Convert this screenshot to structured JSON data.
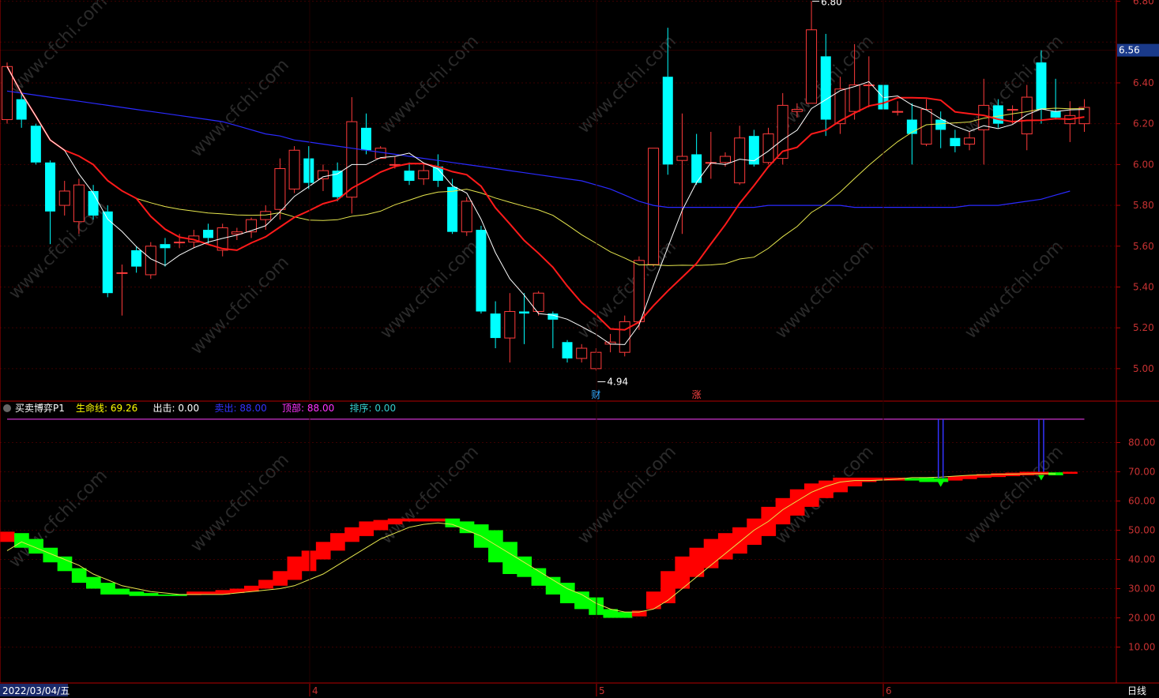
{
  "colors": {
    "up": "#ff3b3b",
    "down": "#00ffff",
    "ma5": "#ffffff",
    "ma10": "#ff1a1a",
    "ma20": "#e6e64d",
    "ma60": "#2a2aff",
    "axis": "#b30000",
    "grid": "#3a0000",
    "green_block": "#00ff00",
    "red_block": "#ff0000",
    "top_line": "#cc33cc",
    "exit_line": "#3333ff"
  },
  "price_axis": {
    "ticks": [
      "6.80",
      "6.40",
      "6.20",
      "6.00",
      "5.80",
      "5.60",
      "5.40",
      "5.20",
      "5.00"
    ],
    "current": "6.56"
  },
  "indicator_axis": {
    "ticks": [
      "80.00",
      "70.00",
      "60.00",
      "50.00",
      "40.00",
      "30.00",
      "20.00",
      "10.00"
    ]
  },
  "annotations": {
    "high_label": "6.80",
    "low_label": "4.94",
    "marker_cai": "财",
    "marker_zhang": "涨"
  },
  "indicator_header": {
    "name": "买卖博弈P1",
    "items": [
      {
        "label": "生命线:",
        "value": "69.26",
        "color": "#ffff00"
      },
      {
        "label": "出击:",
        "value": "0.00",
        "color": "#ffffff"
      },
      {
        "label": "卖出:",
        "value": "88.00",
        "color": "#3333ff"
      },
      {
        "label": "顶部:",
        "value": "88.00",
        "color": "#ff33ff"
      },
      {
        "label": "排序:",
        "value": "0.00",
        "color": "#33cccc"
      }
    ]
  },
  "bottom_bar": {
    "date": "2022/03/04/五",
    "months": [
      "4",
      "5",
      "6"
    ],
    "period": "日线"
  },
  "watermark": "www.cfchi.com",
  "chart_data": [
    {
      "type": "candlestick",
      "ylim": [
        4.88,
        6.82
      ],
      "candles": [
        {
          "o": 6.22,
          "c": 6.48,
          "h": 6.5,
          "l": 6.2
        },
        {
          "o": 6.32,
          "c": 6.22,
          "h": 6.35,
          "l": 6.18
        },
        {
          "o": 6.19,
          "c": 6.01,
          "h": 6.2,
          "l": 6.0
        },
        {
          "o": 6.01,
          "c": 5.77,
          "h": 6.02,
          "l": 5.61
        },
        {
          "o": 5.8,
          "c": 5.87,
          "h": 5.92,
          "l": 5.75
        },
        {
          "o": 5.72,
          "c": 5.9,
          "h": 5.93,
          "l": 5.66
        },
        {
          "o": 5.87,
          "c": 5.75,
          "h": 5.9,
          "l": 5.73
        },
        {
          "o": 5.77,
          "c": 5.37,
          "h": 5.8,
          "l": 5.35
        },
        {
          "o": 5.47,
          "c": 5.47,
          "h": 5.51,
          "l": 5.26
        },
        {
          "o": 5.58,
          "c": 5.5,
          "h": 5.6,
          "l": 5.47
        },
        {
          "o": 5.46,
          "c": 5.6,
          "h": 5.62,
          "l": 5.44
        },
        {
          "o": 5.61,
          "c": 5.59,
          "h": 5.64,
          "l": 5.5
        },
        {
          "o": 5.62,
          "c": 5.62,
          "h": 5.66,
          "l": 5.59
        },
        {
          "o": 5.62,
          "c": 5.65,
          "h": 5.68,
          "l": 5.59
        },
        {
          "o": 5.68,
          "c": 5.64,
          "h": 5.71,
          "l": 5.61
        },
        {
          "o": 5.58,
          "c": 5.69,
          "h": 5.71,
          "l": 5.55
        },
        {
          "o": 5.66,
          "c": 5.67,
          "h": 5.69,
          "l": 5.63
        },
        {
          "o": 5.67,
          "c": 5.73,
          "h": 5.74,
          "l": 5.64
        },
        {
          "o": 5.73,
          "c": 5.77,
          "h": 5.8,
          "l": 5.68
        },
        {
          "o": 5.78,
          "c": 5.98,
          "h": 6.03,
          "l": 5.73
        },
        {
          "o": 5.88,
          "c": 6.07,
          "h": 6.09,
          "l": 5.86
        },
        {
          "o": 6.03,
          "c": 5.91,
          "h": 6.09,
          "l": 5.88
        },
        {
          "o": 5.93,
          "c": 5.97,
          "h": 6.0,
          "l": 5.87
        },
        {
          "o": 5.97,
          "c": 5.84,
          "h": 6.01,
          "l": 5.82
        },
        {
          "o": 5.84,
          "c": 6.21,
          "h": 6.33,
          "l": 5.76
        },
        {
          "o": 6.18,
          "c": 6.07,
          "h": 6.25,
          "l": 6.05
        },
        {
          "o": 6.03,
          "c": 6.08,
          "h": 6.09,
          "l": 6.03
        },
        {
          "o": 6.0,
          "c": 6.0,
          "h": 6.04,
          "l": 5.98
        },
        {
          "o": 5.97,
          "c": 5.92,
          "h": 6.01,
          "l": 5.9
        },
        {
          "o": 5.93,
          "c": 5.97,
          "h": 6.0,
          "l": 5.9
        },
        {
          "o": 5.99,
          "c": 5.92,
          "h": 6.05,
          "l": 5.89
        },
        {
          "o": 5.89,
          "c": 5.67,
          "h": 5.93,
          "l": 5.66
        },
        {
          "o": 5.67,
          "c": 5.82,
          "h": 5.84,
          "l": 5.65
        },
        {
          "o": 5.68,
          "c": 5.28,
          "h": 5.7,
          "l": 5.27
        },
        {
          "o": 5.27,
          "c": 5.15,
          "h": 5.33,
          "l": 5.1
        },
        {
          "o": 5.15,
          "c": 5.28,
          "h": 5.37,
          "l": 5.03
        },
        {
          "o": 5.28,
          "c": 5.27,
          "h": 5.37,
          "l": 5.12
        },
        {
          "o": 5.28,
          "c": 5.37,
          "h": 5.38,
          "l": 5.26
        },
        {
          "o": 5.27,
          "c": 5.24,
          "h": 5.28,
          "l": 5.1
        },
        {
          "o": 5.13,
          "c": 5.05,
          "h": 5.14,
          "l": 5.03
        },
        {
          "o": 5.05,
          "c": 5.1,
          "h": 5.12,
          "l": 5.03
        },
        {
          "o": 5.0,
          "c": 5.08,
          "h": 5.1,
          "l": 4.99
        },
        {
          "o": 5.12,
          "c": 5.13,
          "h": 5.17,
          "l": 5.08
        },
        {
          "o": 5.08,
          "c": 5.23,
          "h": 5.26,
          "l": 5.06
        },
        {
          "o": 5.23,
          "c": 5.53,
          "h": 5.55,
          "l": 5.19
        },
        {
          "o": 5.51,
          "c": 6.08,
          "h": 6.08,
          "l": 5.5
        },
        {
          "o": 6.43,
          "c": 6.0,
          "h": 6.67,
          "l": 5.95
        },
        {
          "o": 6.02,
          "c": 6.04,
          "h": 6.25,
          "l": 5.66
        },
        {
          "o": 6.05,
          "c": 5.91,
          "h": 6.15,
          "l": 5.9
        },
        {
          "o": 6.01,
          "c": 6.01,
          "h": 6.16,
          "l": 5.93
        },
        {
          "o": 6.01,
          "c": 6.04,
          "h": 6.06,
          "l": 5.99
        },
        {
          "o": 5.91,
          "c": 6.13,
          "h": 6.19,
          "l": 5.9
        },
        {
          "o": 6.14,
          "c": 6.0,
          "h": 6.17,
          "l": 5.99
        },
        {
          "o": 6.01,
          "c": 6.15,
          "h": 6.18,
          "l": 6.0
        },
        {
          "o": 6.03,
          "c": 6.29,
          "h": 6.35,
          "l": 6.0
        },
        {
          "o": 6.26,
          "c": 6.27,
          "h": 6.3,
          "l": 6.23
        },
        {
          "o": 6.3,
          "c": 6.66,
          "h": 6.8,
          "l": 6.3
        },
        {
          "o": 6.53,
          "c": 6.22,
          "h": 6.64,
          "l": 6.14
        },
        {
          "o": 6.2,
          "c": 6.37,
          "h": 6.43,
          "l": 6.15
        },
        {
          "o": 6.26,
          "c": 6.39,
          "h": 6.59,
          "l": 6.22
        },
        {
          "o": 6.39,
          "c": 6.39,
          "h": 6.53,
          "l": 6.28
        },
        {
          "o": 6.39,
          "c": 6.27,
          "h": 6.41,
          "l": 6.26
        },
        {
          "o": 6.26,
          "c": 6.26,
          "h": 6.31,
          "l": 6.24
        },
        {
          "o": 6.22,
          "c": 6.15,
          "h": 6.3,
          "l": 6.0
        },
        {
          "o": 6.1,
          "c": 6.27,
          "h": 6.32,
          "l": 6.09
        },
        {
          "o": 6.22,
          "c": 6.17,
          "h": 6.26,
          "l": 6.08
        },
        {
          "o": 6.13,
          "c": 6.09,
          "h": 6.17,
          "l": 6.06
        },
        {
          "o": 6.1,
          "c": 6.13,
          "h": 6.16,
          "l": 6.07
        },
        {
          "o": 6.17,
          "c": 6.29,
          "h": 6.42,
          "l": 6.0
        },
        {
          "o": 6.29,
          "c": 6.2,
          "h": 6.32,
          "l": 6.18
        },
        {
          "o": 6.27,
          "c": 6.27,
          "h": 6.29,
          "l": 6.2
        },
        {
          "o": 6.15,
          "c": 6.33,
          "h": 6.39,
          "l": 6.07
        },
        {
          "o": 6.5,
          "c": 6.27,
          "h": 6.56,
          "l": 6.2
        },
        {
          "o": 6.26,
          "c": 6.23,
          "h": 6.42,
          "l": 6.22
        },
        {
          "o": 6.2,
          "c": 6.24,
          "h": 6.31,
          "l": 6.11
        },
        {
          "o": 6.2,
          "c": 6.28,
          "h": 6.32,
          "l": 6.16
        }
      ],
      "ma60": [
        6.36,
        6.35,
        6.34,
        6.33,
        6.32,
        6.31,
        6.3,
        6.29,
        6.28,
        6.27,
        6.26,
        6.25,
        6.24,
        6.23,
        6.22,
        6.21,
        6.19,
        6.17,
        6.15,
        6.14,
        6.12,
        6.11,
        6.1,
        6.09,
        6.08,
        6.07,
        6.06,
        6.05,
        6.04,
        6.03,
        6.02,
        6.01,
        6.0,
        5.99,
        5.98,
        5.97,
        5.96,
        5.95,
        5.94,
        5.93,
        5.92,
        5.9,
        5.88,
        5.85,
        5.82,
        5.8,
        5.79,
        5.79,
        5.79,
        5.79,
        5.79,
        5.79,
        5.79,
        5.8,
        5.8,
        5.8,
        5.8,
        5.8,
        5.8,
        5.79,
        5.79,
        5.79,
        5.79,
        5.79,
        5.79,
        5.79,
        5.79,
        5.8,
        5.8,
        5.8,
        5.81,
        5.82,
        5.83,
        5.85,
        5.87
      ]
    },
    {
      "type": "indicator",
      "name": "买卖博弈P1",
      "ylim": [
        0,
        92
      ],
      "top_line": 88,
      "blocks": [
        {
          "bottom": 46,
          "top": 49.5,
          "color": "red"
        },
        {
          "bottom": 44,
          "top": 49,
          "color": "green"
        },
        {
          "bottom": 42,
          "top": 47,
          "color": "green"
        },
        {
          "bottom": 39,
          "top": 44,
          "color": "green"
        },
        {
          "bottom": 36,
          "top": 41,
          "color": "green"
        },
        {
          "bottom": 32,
          "top": 37,
          "color": "green"
        },
        {
          "bottom": 30,
          "top": 34,
          "color": "green"
        },
        {
          "bottom": 28,
          "top": 32,
          "color": "green"
        },
        {
          "bottom": 28,
          "top": 30,
          "color": "green"
        },
        {
          "bottom": 27.5,
          "top": 29,
          "color": "green"
        },
        {
          "bottom": 27.5,
          "top": 28.5,
          "color": "green"
        },
        {
          "bottom": 27.5,
          "top": 28,
          "color": "green"
        },
        {
          "bottom": 27.5,
          "top": 28,
          "color": "green"
        },
        {
          "bottom": 27.8,
          "top": 29,
          "color": "red"
        },
        {
          "bottom": 28,
          "top": 29,
          "color": "red"
        },
        {
          "bottom": 28,
          "top": 29.5,
          "color": "red"
        },
        {
          "bottom": 28.5,
          "top": 30,
          "color": "red"
        },
        {
          "bottom": 29,
          "top": 31,
          "color": "red"
        },
        {
          "bottom": 30,
          "top": 33,
          "color": "red"
        },
        {
          "bottom": 31,
          "top": 36,
          "color": "red"
        },
        {
          "bottom": 33,
          "top": 41,
          "color": "red"
        },
        {
          "bottom": 36,
          "top": 43,
          "color": "red"
        },
        {
          "bottom": 40,
          "top": 46,
          "color": "red"
        },
        {
          "bottom": 43,
          "top": 49,
          "color": "red"
        },
        {
          "bottom": 46,
          "top": 51,
          "color": "red"
        },
        {
          "bottom": 48,
          "top": 53,
          "color": "red"
        },
        {
          "bottom": 50,
          "top": 53.5,
          "color": "red"
        },
        {
          "bottom": 52,
          "top": 54,
          "color": "red"
        },
        {
          "bottom": 53,
          "top": 54,
          "color": "red"
        },
        {
          "bottom": 53,
          "top": 54,
          "color": "red"
        },
        {
          "bottom": 53,
          "top": 54,
          "color": "red"
        },
        {
          "bottom": 51,
          "top": 54,
          "color": "green"
        },
        {
          "bottom": 49,
          "top": 53,
          "color": "green"
        },
        {
          "bottom": 44,
          "top": 52,
          "color": "green"
        },
        {
          "bottom": 39,
          "top": 50,
          "color": "green"
        },
        {
          "bottom": 35,
          "top": 46,
          "color": "green"
        },
        {
          "bottom": 34,
          "top": 41,
          "color": "green"
        },
        {
          "bottom": 31,
          "top": 37,
          "color": "green"
        },
        {
          "bottom": 28,
          "top": 34,
          "color": "green"
        },
        {
          "bottom": 25,
          "top": 32,
          "color": "green"
        },
        {
          "bottom": 23,
          "top": 29,
          "color": "green"
        },
        {
          "bottom": 21,
          "top": 27,
          "color": "green"
        },
        {
          "bottom": 20,
          "top": 23,
          "color": "green"
        },
        {
          "bottom": 20,
          "top": 22,
          "color": "green"
        },
        {
          "bottom": 20.5,
          "top": 22.5,
          "color": "red"
        },
        {
          "bottom": 23,
          "top": 29,
          "color": "red"
        },
        {
          "bottom": 25,
          "top": 36,
          "color": "red"
        },
        {
          "bottom": 30,
          "top": 41,
          "color": "red"
        },
        {
          "bottom": 34,
          "top": 44,
          "color": "red"
        },
        {
          "bottom": 37,
          "top": 47,
          "color": "red"
        },
        {
          "bottom": 40,
          "top": 49,
          "color": "red"
        },
        {
          "bottom": 42,
          "top": 51,
          "color": "red"
        },
        {
          "bottom": 45,
          "top": 54,
          "color": "red"
        },
        {
          "bottom": 48,
          "top": 58,
          "color": "red"
        },
        {
          "bottom": 52,
          "top": 61,
          "color": "red"
        },
        {
          "bottom": 55,
          "top": 64,
          "color": "red"
        },
        {
          "bottom": 58,
          "top": 66,
          "color": "red"
        },
        {
          "bottom": 61,
          "top": 67,
          "color": "red"
        },
        {
          "bottom": 63,
          "top": 68,
          "color": "red"
        },
        {
          "bottom": 65,
          "top": 68,
          "color": "red"
        },
        {
          "bottom": 66.5,
          "top": 68,
          "color": "red"
        },
        {
          "bottom": 67,
          "top": 68,
          "color": "red"
        },
        {
          "bottom": 67,
          "top": 68,
          "color": "red"
        },
        {
          "bottom": 67,
          "top": 67.8,
          "color": "green"
        },
        {
          "bottom": 66.5,
          "top": 68,
          "color": "green"
        },
        {
          "bottom": 66.5,
          "top": 67.8,
          "color": "green"
        },
        {
          "bottom": 67,
          "top": 68.5,
          "color": "red"
        },
        {
          "bottom": 67.5,
          "top": 68.8,
          "color": "red"
        },
        {
          "bottom": 68,
          "top": 69.2,
          "color": "red"
        },
        {
          "bottom": 68.2,
          "top": 69.5,
          "color": "red"
        },
        {
          "bottom": 68.5,
          "top": 69.7,
          "color": "red"
        },
        {
          "bottom": 68.8,
          "top": 70,
          "color": "red"
        },
        {
          "bottom": 69,
          "top": 70,
          "color": "red"
        },
        {
          "bottom": 68.8,
          "top": 69.8,
          "color": "green"
        },
        {
          "bottom": 69.3,
          "top": 70,
          "color": "red"
        }
      ],
      "life_line": [
        43,
        46,
        44,
        42,
        40,
        38,
        35,
        33,
        31,
        30,
        29,
        28.5,
        28,
        28,
        28,
        28,
        28.5,
        29,
        29.5,
        30,
        31,
        33,
        35,
        38,
        41,
        44,
        47,
        49,
        51,
        52,
        52.5,
        52,
        50,
        48,
        45,
        42,
        39,
        36,
        33,
        30,
        28,
        25,
        23,
        22,
        22,
        23,
        26,
        30,
        34,
        38,
        42,
        46,
        50,
        53,
        57,
        60,
        63,
        65,
        66.5,
        67,
        67,
        67.2,
        67.5,
        68,
        68,
        68.2,
        68.5,
        68.8,
        69,
        69.1,
        69.2,
        69.3,
        69.4,
        69.3
      ]
    }
  ]
}
